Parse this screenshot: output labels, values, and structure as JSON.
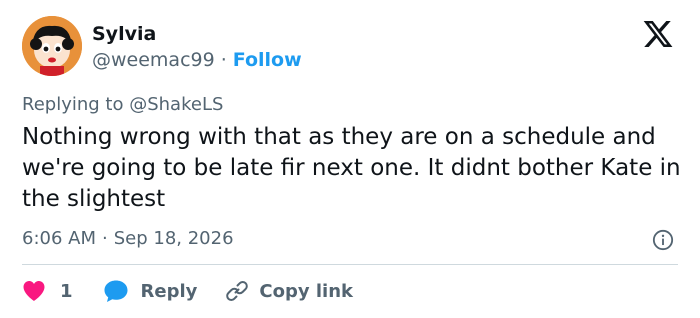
{
  "user": {
    "name": "Sylvia",
    "handle": "@weemac99",
    "separator": "·",
    "follow_label": "Follow",
    "avatar_icon": "cartoon-avatar-icon"
  },
  "platform": {
    "logo_icon": "x-logo-icon"
  },
  "reply_context": {
    "prefix": "Replying to",
    "mention": "@ShakeLS"
  },
  "tweet": {
    "text": "Nothing wrong with that as they are on a schedule and we're going to be late fir next one. It didnt bother Kate in the slightest"
  },
  "meta": {
    "time": "6:06 AM",
    "separator": "·",
    "date": "Sep 18, 2026",
    "info_icon": "info-icon"
  },
  "actions": {
    "like_count": "1",
    "reply_label": "Reply",
    "copy_label": "Copy link"
  },
  "colors": {
    "like": "#f91880",
    "reply": "#1d9bf0",
    "follow": "#1d9bf0",
    "secondary_text": "#536471",
    "primary_text": "#0f1419"
  }
}
